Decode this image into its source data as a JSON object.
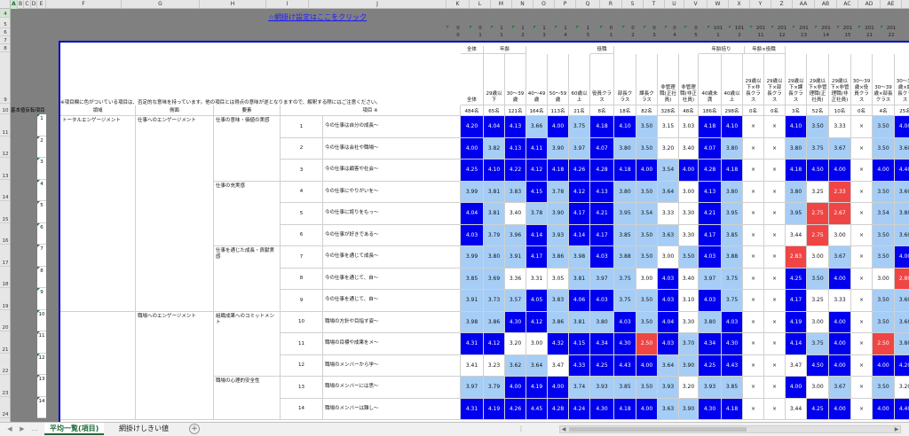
{
  "sheet_title_link": "☆網掛け設定はここをクリック",
  "selected_cell": "A1",
  "col_headers": [
    "A",
    "B",
    "C",
    "D",
    "E",
    "F",
    "G",
    "H",
    "I",
    "J",
    "K",
    "L",
    "M",
    "N",
    "O",
    "P",
    "Q",
    "R",
    "S",
    "T",
    "U",
    "V",
    "W",
    "X",
    "Y",
    "Z",
    "AA",
    "AB",
    "AC",
    "AD",
    "AE"
  ],
  "row_numbers": [
    "4",
    "5",
    "6",
    "7",
    "8",
    "9",
    "10",
    "",
    "11",
    "",
    "12",
    "",
    "13",
    "",
    "14",
    "",
    "15",
    "",
    "16",
    "",
    "17",
    "",
    "18",
    "",
    "19",
    "",
    "20",
    "",
    "21",
    "",
    "22",
    "",
    "23",
    "",
    "24"
  ],
  "top_codes_l1": [
    "0",
    "0",
    "1",
    "1",
    "1",
    "1",
    "1",
    "0",
    "0",
    "0",
    "0",
    "0",
    "101",
    "101",
    "201",
    "201",
    "201",
    "201",
    "201",
    "201",
    "201"
  ],
  "top_codes_l2": [
    "0",
    "1",
    "1",
    "2",
    "3",
    "4",
    "5",
    "1",
    "2",
    "3",
    "4",
    "5",
    "1",
    "2",
    "11",
    "12",
    "13",
    "14",
    "15",
    "21",
    "22",
    "23"
  ],
  "notes_row9": "※項目欄に色がついている項目は、否定的な意味を持っています。他の項目とは得点の意味が逆となりますので、解釈する際にはご注意ください。",
  "row10_header": {
    "base": "基本値反転項目",
    "realm": "領域",
    "side": "側面",
    "element": "要素",
    "item": "項目 ※"
  },
  "group_labels": {
    "total": "全体",
    "age": "年齢",
    "role": "役職",
    "age_end": "年齢括り",
    "age_role": "年齢×役職"
  },
  "col_labels": [
    "全体",
    "29歳以下",
    "30〜39歳",
    "40〜49歳",
    "50〜59歳",
    "60歳以上",
    "役員クラス",
    "部長クラス",
    "課長クラス",
    "非管理職(正社員)",
    "非管理職(非正社員)",
    "40歳未満",
    "40歳以上",
    "29歳以下×非長クラス",
    "29歳以下×部長クラス",
    "29歳以下×課長クラス",
    "29歳以下×非管理職(正社員)",
    "29歳以下×非管理職(非正社員)",
    "30〜39歳×役員クラス",
    "30〜39歳×部長クラス",
    "30〜39歳×課長クラス"
  ],
  "counts": [
    "484名",
    "65名",
    "121名",
    "164名",
    "113名",
    "21名",
    "8名",
    "18名",
    "82名",
    "328名",
    "48名",
    "186名",
    "298名",
    "0名",
    "0名",
    "3名",
    "52名",
    "10名",
    "0名",
    "4名",
    "25名"
  ],
  "realms": [
    "トータルエンゲージメント",
    "職場へのエンゲージメント"
  ],
  "sides": [
    "仕事へのエンゲージメント",
    "職場へのエンゲージメント"
  ],
  "elements": [
    "仕事の意味・価値の実感",
    "仕事の充実感",
    "仕事を通じた成長・貢献実感",
    "組織成果へのコミットメント",
    "職場の心理的安全性"
  ],
  "rows": [
    {
      "no": "1",
      "text": "今の仕事は自分の成長～",
      "values": [
        "4.20",
        "4.04",
        "4.13",
        "3.66",
        "4.00",
        "3.75",
        "4.18",
        "4.10",
        "3.50",
        "3.15",
        "3.03",
        "4.18",
        "4.10",
        "×",
        "×",
        "4.10",
        "3.50",
        "3.33",
        "×",
        "3.50",
        "4.00"
      ]
    },
    {
      "no": "2",
      "text": "今の仕事は会社や職場～",
      "values": [
        "4.00",
        "3.82",
        "4.13",
        "4.11",
        "3.90",
        "3.97",
        "4.07",
        "3.80",
        "3.50",
        "3.20",
        "3.40",
        "4.07",
        "3.80",
        "×",
        "×",
        "3.80",
        "3.75",
        "3.67",
        "×",
        "3.50",
        "3.60"
      ]
    },
    {
      "no": "3",
      "text": "今の仕事は顧客や社会～",
      "values": [
        "4.25",
        "4.10",
        "4.22",
        "4.12",
        "4.18",
        "4.26",
        "4.28",
        "4.18",
        "4.00",
        "3.54",
        "4.00",
        "4.28",
        "4.18",
        "×",
        "×",
        "4.18",
        "4.50",
        "4.00",
        "×",
        "4.00",
        "4.40"
      ]
    },
    {
      "no": "4",
      "text": "今の仕事にやりがいを～",
      "values": [
        "3.99",
        "3.81",
        "3.83",
        "4.15",
        "3.78",
        "4.12",
        "4.13",
        "3.80",
        "3.50",
        "3.64",
        "3.00",
        "4.13",
        "3.80",
        "×",
        "×",
        "3.80",
        "3.25",
        "2.33",
        "×",
        "3.50",
        "3.60"
      ]
    },
    {
      "no": "5",
      "text": "今の仕事に誇りをもっ～",
      "values": [
        "4.04",
        "3.81",
        "3.40",
        "3.78",
        "3.90",
        "4.17",
        "4.21",
        "3.95",
        "3.54",
        "3.33",
        "3.30",
        "4.21",
        "3.95",
        "×",
        "×",
        "3.95",
        "2.75",
        "2.67",
        "×",
        "3.54",
        "3.80"
      ]
    },
    {
      "no": "6",
      "text": "今の仕事が好きである～",
      "values": [
        "4.03",
        "3.79",
        "3.96",
        "4.14",
        "3.93",
        "4.14",
        "4.17",
        "3.85",
        "3.50",
        "3.63",
        "3.30",
        "4.17",
        "3.85",
        "×",
        "×",
        "3.44",
        "2.75",
        "3.00",
        "×",
        "3.50",
        "3.60"
      ]
    },
    {
      "no": "7",
      "text": "今の仕事を通じて成長～",
      "values": [
        "3.99",
        "3.80",
        "3.91",
        "4.17",
        "3.86",
        "3.98",
        "4.03",
        "3.88",
        "3.50",
        "3.00",
        "3.50",
        "4.03",
        "3.88",
        "×",
        "×",
        "2.83",
        "3.00",
        "3.67",
        "×",
        "3.50",
        "4.00"
      ]
    },
    {
      "no": "8",
      "text": "今の仕事を通じて、自～",
      "values": [
        "3.85",
        "3.69",
        "3.36",
        "3.31",
        "3.05",
        "3.81",
        "3.97",
        "3.75",
        "3.00",
        "4.03",
        "3.40",
        "3.97",
        "3.75",
        "×",
        "×",
        "4.25",
        "3.50",
        "4.00",
        "×",
        "3.00",
        "2.80"
      ]
    },
    {
      "no": "9",
      "text": "今の仕事を通じて、自～",
      "values": [
        "3.91",
        "3.73",
        "3.57",
        "4.05",
        "3.83",
        "4.06",
        "4.03",
        "3.75",
        "3.50",
        "4.03",
        "3.10",
        "4.03",
        "3.75",
        "×",
        "×",
        "4.17",
        "3.25",
        "3.33",
        "×",
        "3.50",
        "3.60"
      ]
    },
    {
      "no": "10",
      "text": "職場の方針や目指す姿～",
      "values": [
        "3.98",
        "3.86",
        "4.30",
        "4.12",
        "3.86",
        "3.81",
        "3.80",
        "4.03",
        "3.50",
        "4.04",
        "3.30",
        "3.80",
        "4.03",
        "×",
        "×",
        "4.19",
        "3.00",
        "4.00",
        "×",
        "3.50",
        "3.60"
      ]
    },
    {
      "no": "11",
      "text": "職場の目標や成果をメ～",
      "values": [
        "4.31",
        "4.12",
        "3.20",
        "3.00",
        "4.32",
        "4.15",
        "4.34",
        "4.30",
        "2.50",
        "4.03",
        "3.70",
        "4.34",
        "4.30",
        "×",
        "×",
        "4.14",
        "3.75",
        "4.00",
        "×",
        "2.50",
        "3.80"
      ]
    },
    {
      "no": "12",
      "text": "職場のメンバーから学～",
      "values": [
        "3.41",
        "3.23",
        "3.62",
        "3.64",
        "3.47",
        "4.33",
        "4.25",
        "4.43",
        "4.00",
        "3.64",
        "3.90",
        "4.25",
        "4.43",
        "×",
        "×",
        "3.47",
        "4.50",
        "4.00",
        "×",
        "4.00",
        "4.20"
      ]
    },
    {
      "no": "13",
      "text": "職場のメンバーには思～",
      "values": [
        "3.97",
        "3.79",
        "4.00",
        "4.19",
        "4.00",
        "3.74",
        "3.93",
        "3.85",
        "3.50",
        "3.93",
        "3.20",
        "3.93",
        "3.85",
        "×",
        "×",
        "4.00",
        "3.00",
        "3.67",
        "×",
        "3.50",
        "3.20"
      ]
    },
    {
      "no": "14",
      "text": "職場のメンバーは難し～",
      "values": [
        "4.31",
        "4.19",
        "4.26",
        "4.45",
        "4.28",
        "4.24",
        "4.30",
        "4.18",
        "4.00",
        "3.63",
        "3.90",
        "4.30",
        "4.18",
        "×",
        "×",
        "3.44",
        "4.25",
        "4.00",
        "×",
        "4.00",
        "4.40"
      ]
    }
  ],
  "sheet_tabs": [
    "平均一覧(項目)",
    "網掛けしきい値"
  ],
  "active_tab_index": 0,
  "add_sheet_symbol": "+",
  "colors": {
    "dark_blue": "#0000ee",
    "light_blue": "#a6cdf5",
    "red": "#f04545",
    "white": "#ffffff",
    "link": "#1a1aff",
    "green": "#1e6a38"
  }
}
